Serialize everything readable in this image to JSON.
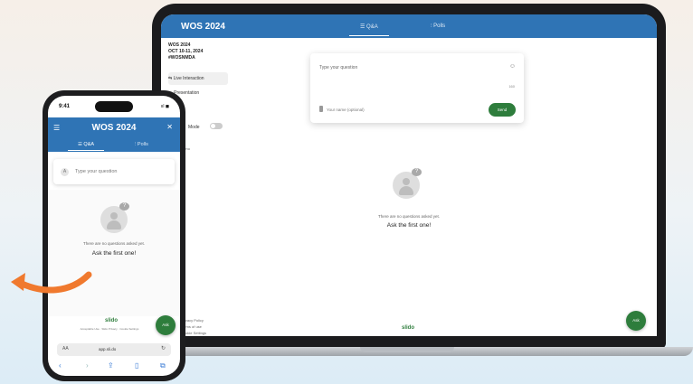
{
  "laptop": {
    "app_title": "WOS 2024",
    "tabs": [
      {
        "label": "Q&A"
      },
      {
        "label": "Polls"
      }
    ],
    "event": {
      "name": "WOS 2024",
      "dates": "OCT 10-11, 2024",
      "code": "#WOSNMDA"
    },
    "sidebar": {
      "nav": [
        {
          "label": "Live Interaction"
        },
        {
          "label": "Presentation"
        }
      ],
      "mode_label": "Mode",
      "extra": "Menu"
    },
    "question_card": {
      "placeholder": "Type your question",
      "emoji_icon": "smile-icon",
      "char_count": "160",
      "name_placeholder": "Your name (optional)",
      "send_label": "Send"
    },
    "empty_state": {
      "text": "There are no questions asked yet.",
      "cta": "Ask the first one!"
    },
    "footer": {
      "lines": [
        "Privacy Policy",
        "Terms of use",
        "Cookie Settings"
      ],
      "logo": "slido"
    },
    "fab_label": "Ask"
  },
  "phone": {
    "status_time": "9:41",
    "status_right": "ııl ◼",
    "app_title": "WOS 2024",
    "tabs": [
      {
        "label": "Q&A"
      },
      {
        "label": "Polls"
      }
    ],
    "input_placeholder": "Type your question",
    "empty_state": {
      "text": "There are no questions asked yet.",
      "cta": "Ask the first one!"
    },
    "footer": {
      "logo": "slido",
      "links": "Acceptable Use   ·   Slido Privacy   ·   Cookie Settings"
    },
    "fab_label": "Ask",
    "url_bar": {
      "left": "AA",
      "address": "app.sli.do",
      "reload_icon": "reload-icon"
    },
    "colors": {
      "brand_blue": "#2f74b5",
      "action_green": "#2e7d3c",
      "arrow_orange": "#f0792e"
    }
  }
}
